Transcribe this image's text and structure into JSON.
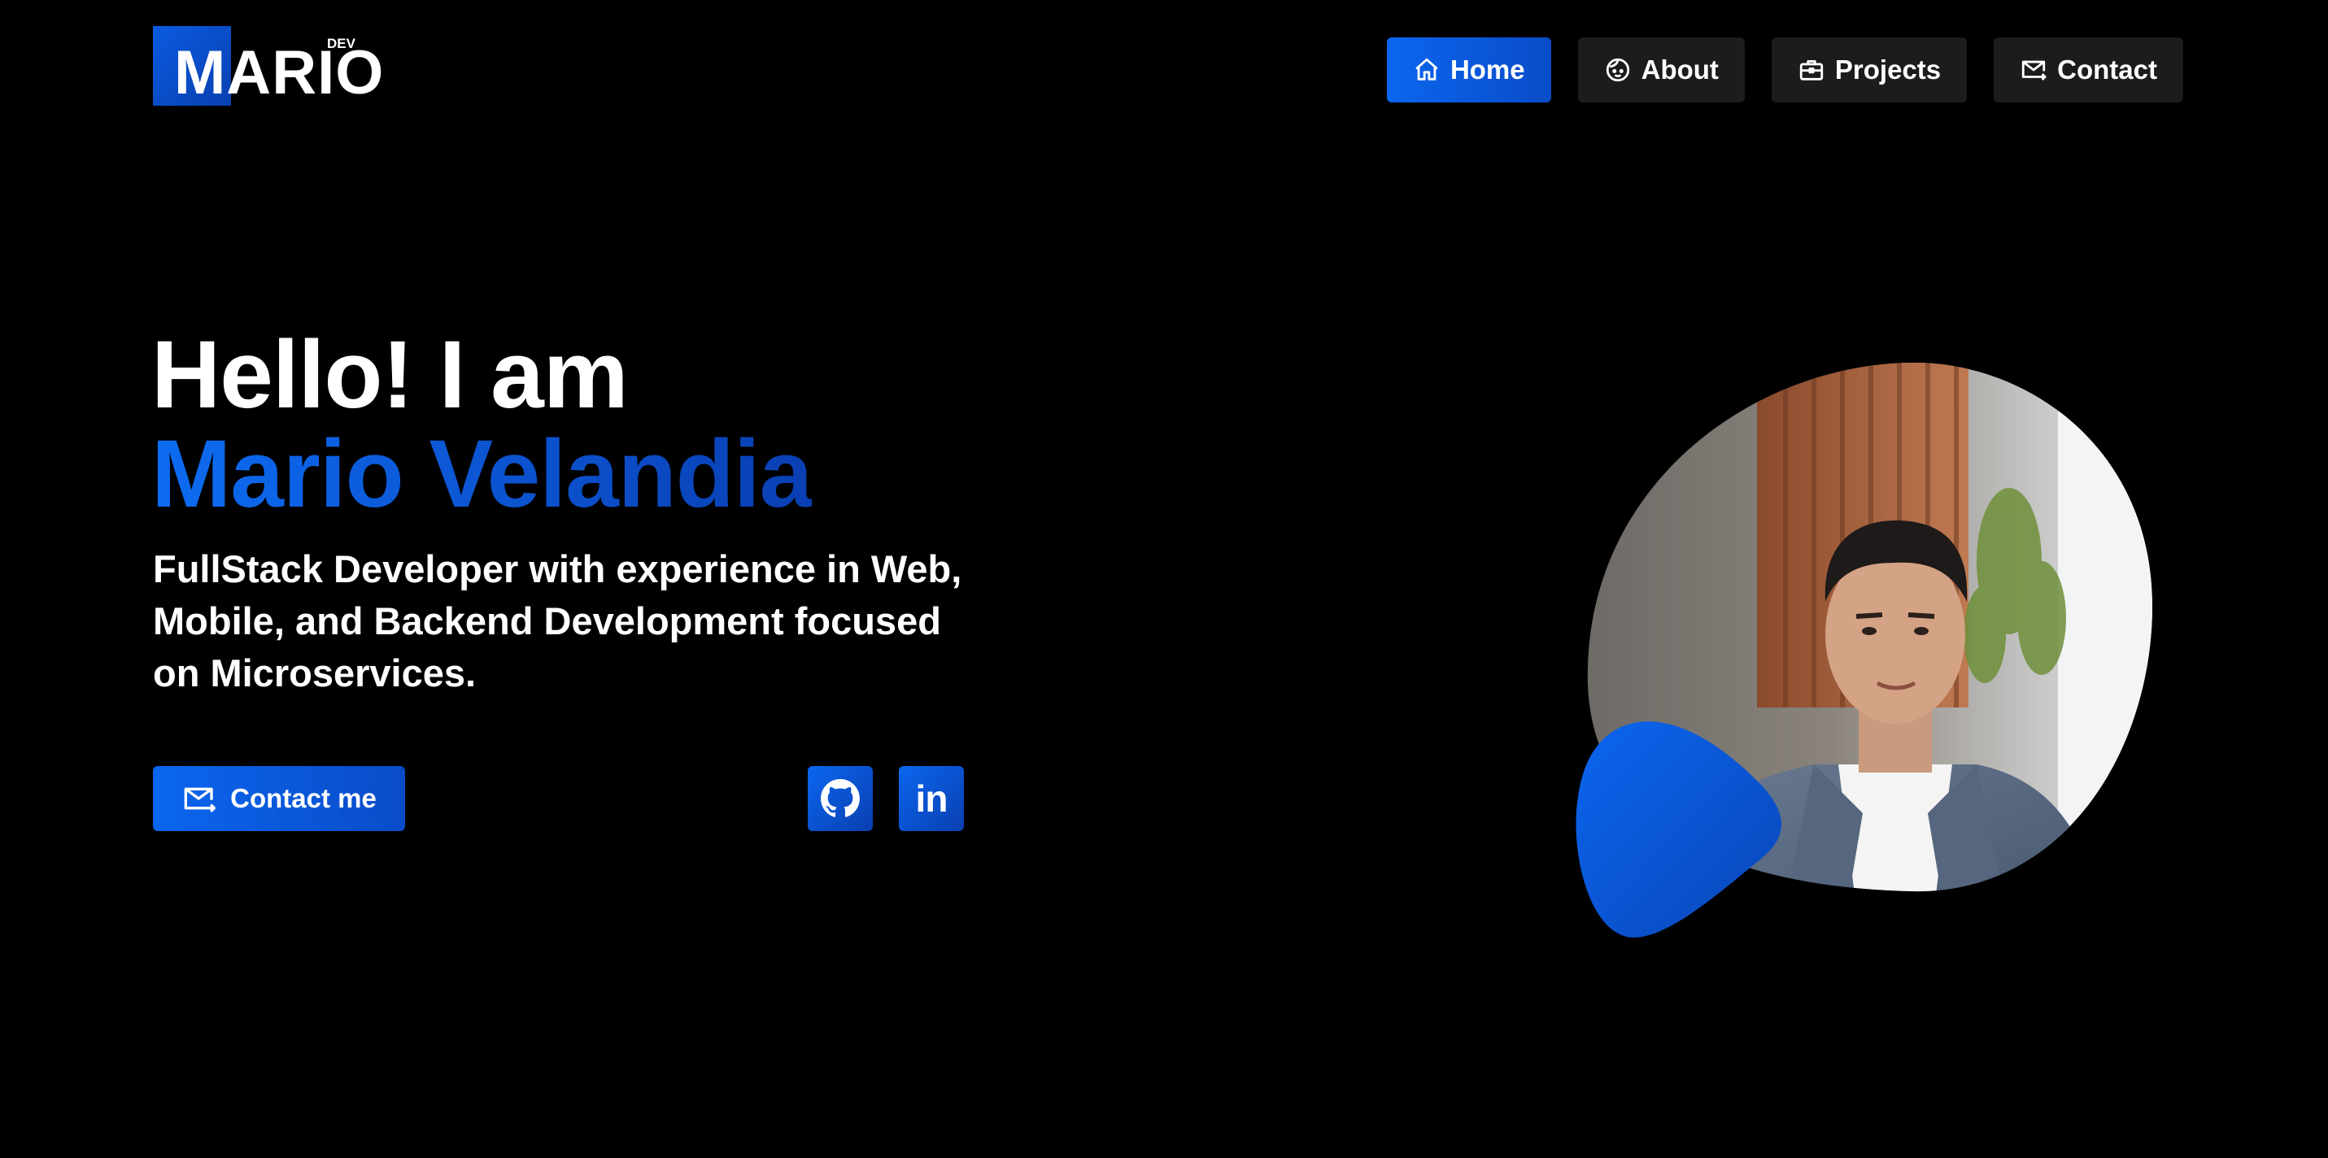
{
  "logo": {
    "text": "MARIO",
    "badge": "DEV"
  },
  "nav": {
    "items": [
      {
        "label": "Home",
        "icon": "home-icon",
        "active": true
      },
      {
        "label": "About",
        "icon": "face-icon",
        "active": false
      },
      {
        "label": "Projects",
        "icon": "briefcase-icon",
        "active": false
      },
      {
        "label": "Contact",
        "icon": "mail-icon",
        "active": false
      }
    ]
  },
  "hero": {
    "greeting": "Hello! I am",
    "name": "Mario Velandia",
    "description": "FullStack Developer with experience in Web, Mobile, and Backend Development focused on Microservices.",
    "contact_label": "Contact me",
    "socials": [
      {
        "icon": "github-icon"
      },
      {
        "icon": "linkedin-icon",
        "glyph": "in"
      }
    ]
  },
  "colors": {
    "background": "#000000",
    "accent": "#0b66ef",
    "accent_dark": "#0a3fb0",
    "nav_inactive": "#1c1c1e",
    "text": "#ffffff"
  }
}
